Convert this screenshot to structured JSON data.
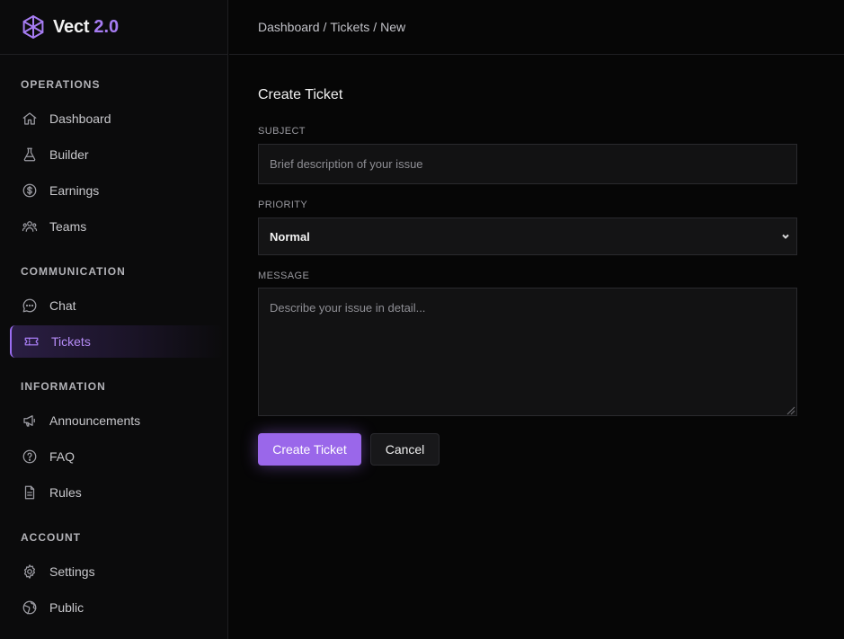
{
  "brand": {
    "name": "Vect",
    "version": "2.0",
    "accent": "#a67cf2",
    "logo_icon": "snowflake-hex-icon"
  },
  "breadcrumb": [
    "Dashboard",
    "Tickets",
    "New"
  ],
  "sidebar": {
    "sections": [
      {
        "title": "OPERATIONS",
        "items": [
          {
            "label": "Dashboard",
            "icon": "home-icon"
          },
          {
            "label": "Builder",
            "icon": "flask-icon"
          },
          {
            "label": "Earnings",
            "icon": "dollar-circle-icon"
          },
          {
            "label": "Teams",
            "icon": "users-icon"
          }
        ]
      },
      {
        "title": "COMMUNICATION",
        "items": [
          {
            "label": "Chat",
            "icon": "chat-bubble-icon"
          },
          {
            "label": "Tickets",
            "icon": "ticket-icon",
            "active": true
          }
        ]
      },
      {
        "title": "INFORMATION",
        "items": [
          {
            "label": "Announcements",
            "icon": "megaphone-icon"
          },
          {
            "label": "FAQ",
            "icon": "question-circle-icon"
          },
          {
            "label": "Rules",
            "icon": "document-icon"
          }
        ]
      },
      {
        "title": "ACCOUNT",
        "items": [
          {
            "label": "Settings",
            "icon": "gear-icon"
          },
          {
            "label": "Public",
            "icon": "globe-icon"
          }
        ]
      }
    ]
  },
  "form": {
    "title": "Create Ticket",
    "subject": {
      "label": "SUBJECT",
      "value": "",
      "placeholder": "Brief description of your issue"
    },
    "priority": {
      "label": "PRIORITY",
      "selected": "Normal"
    },
    "message": {
      "label": "MESSAGE",
      "value": "",
      "placeholder": "Describe your issue in detail..."
    },
    "submit_label": "Create Ticket",
    "cancel_label": "Cancel"
  }
}
